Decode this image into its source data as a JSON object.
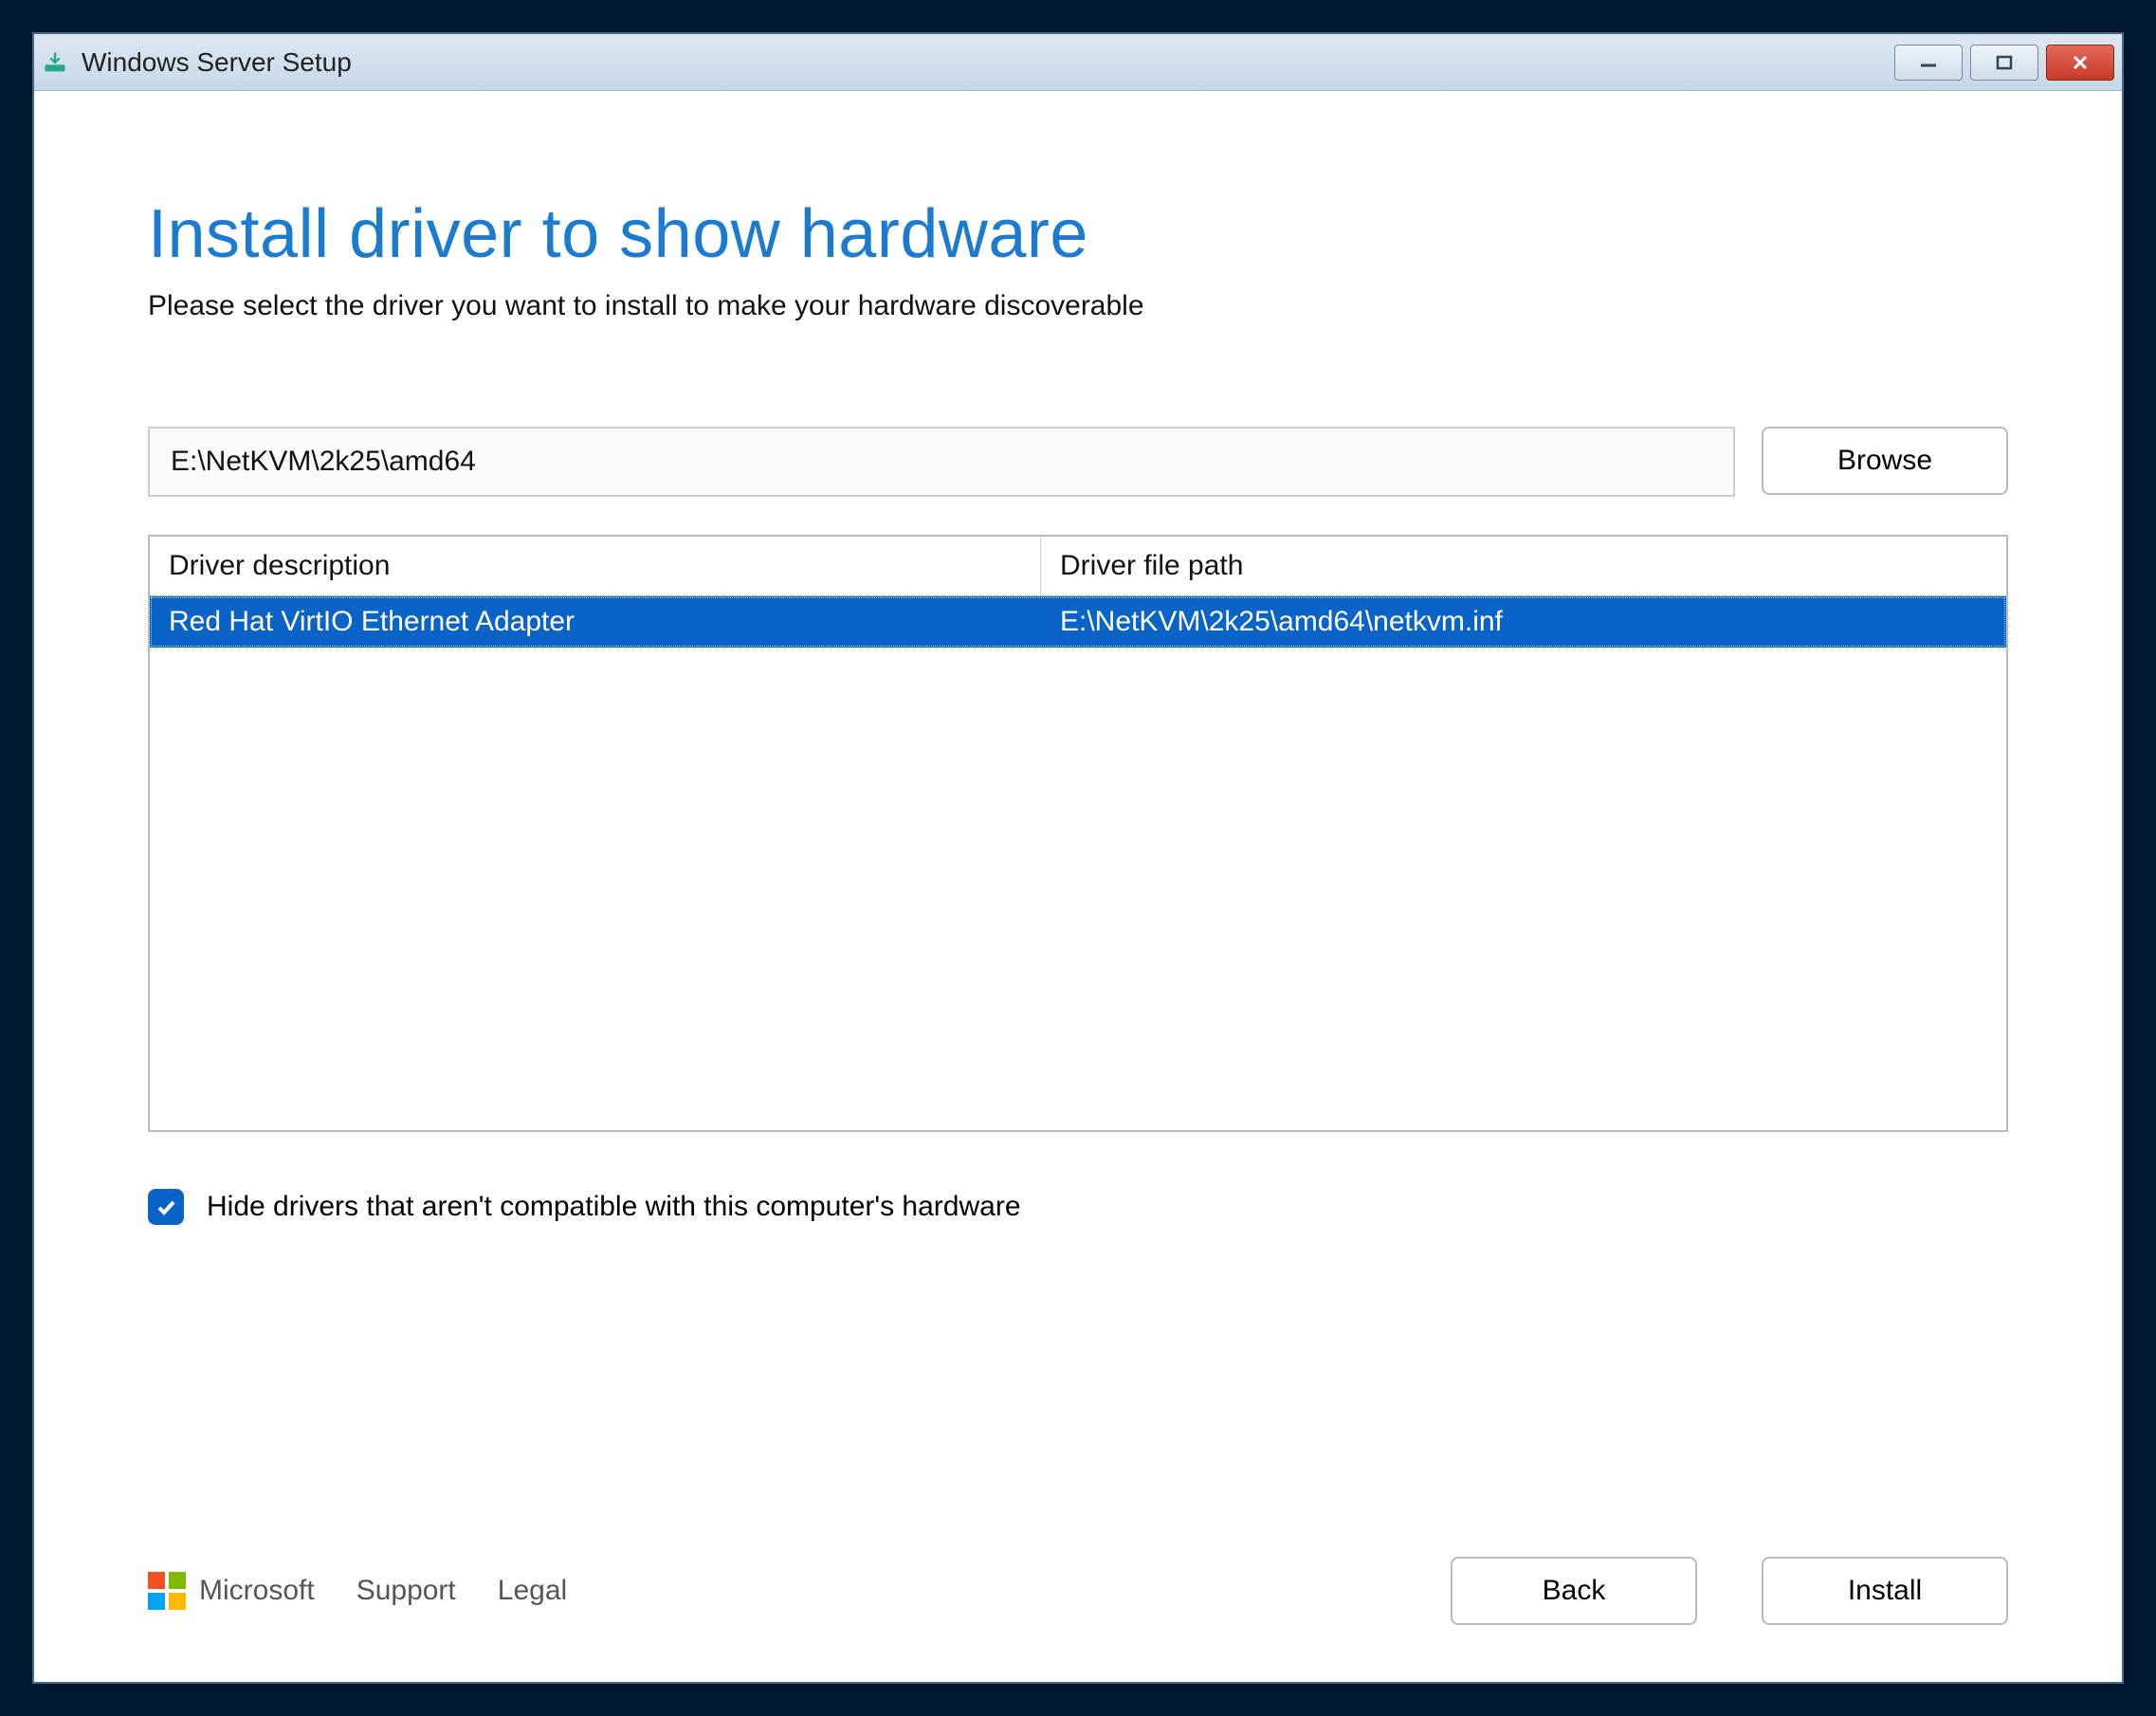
{
  "window": {
    "title": "Windows Server Setup"
  },
  "page": {
    "heading": "Install driver to show hardware",
    "subheading": "Please select the driver you want to install to make your hardware discoverable"
  },
  "path_input": {
    "value": "E:\\NetKVM\\2k25\\amd64"
  },
  "browse_button": "Browse",
  "driver_list": {
    "columns": {
      "description": "Driver description",
      "file_path": "Driver file path"
    },
    "rows": [
      {
        "description": "Red Hat VirtIO Ethernet Adapter",
        "file_path": "E:\\NetKVM\\2k25\\amd64\\netkvm.inf",
        "selected": true
      }
    ]
  },
  "hide_incompatible": {
    "checked": true,
    "label": "Hide drivers that aren't compatible with this computer's hardware"
  },
  "footer": {
    "brand": "Microsoft",
    "support": "Support",
    "legal": "Legal",
    "back": "Back",
    "install": "Install"
  }
}
